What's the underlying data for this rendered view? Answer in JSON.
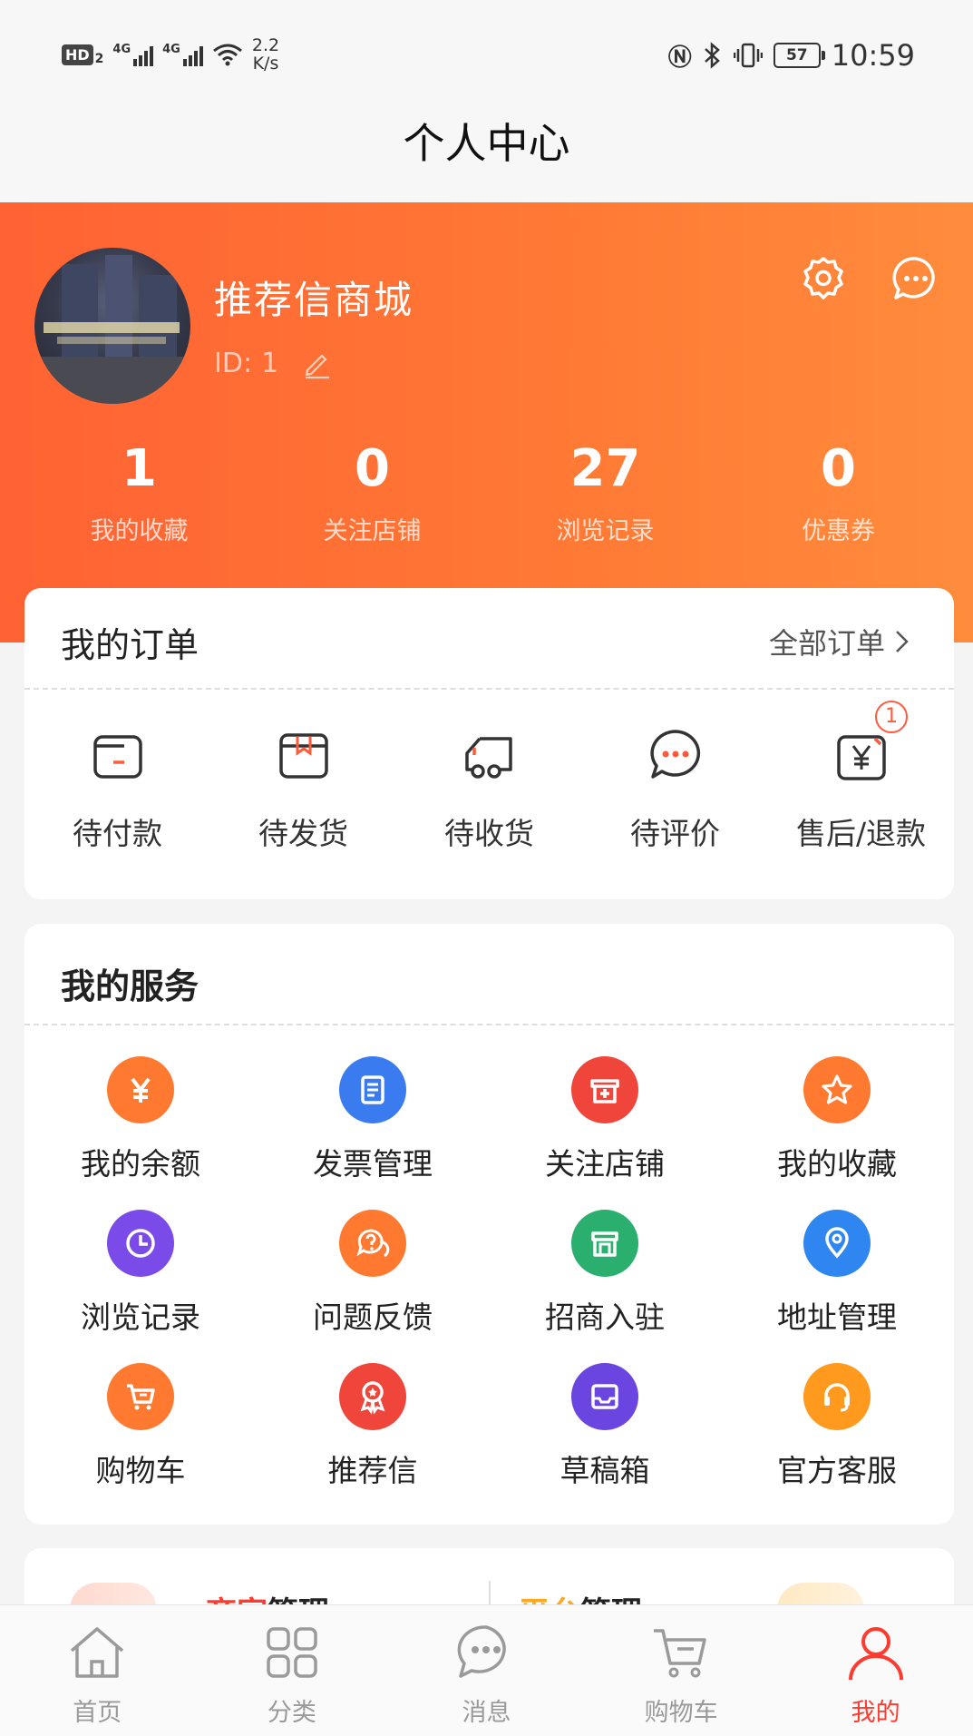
{
  "status_bar": {
    "hd_label": "HD",
    "hd_sub": "2",
    "net1": "4G",
    "net2": "4G",
    "speed_value": "2.2",
    "speed_unit": "K/s",
    "battery": "57",
    "time": "10:59"
  },
  "page": {
    "title": "个人中心"
  },
  "profile": {
    "name": "推荐信商城",
    "id_label": "ID:",
    "id_value": "1"
  },
  "stats": [
    {
      "value": "1",
      "label": "我的收藏"
    },
    {
      "value": "0",
      "label": "关注店铺"
    },
    {
      "value": "27",
      "label": "浏览记录"
    },
    {
      "value": "0",
      "label": "优惠券"
    }
  ],
  "orders": {
    "title": "我的订单",
    "all_label": "全部订单",
    "items": [
      {
        "label": "待付款",
        "icon": "wallet-icon"
      },
      {
        "label": "待发货",
        "icon": "package-icon"
      },
      {
        "label": "待收货",
        "icon": "truck-icon"
      },
      {
        "label": "待评价",
        "icon": "comment-icon"
      },
      {
        "label": "售后/退款",
        "icon": "refund-icon",
        "badge": "1"
      }
    ]
  },
  "services": {
    "title": "我的服务",
    "items": [
      {
        "label": "我的余额",
        "icon": "yen-icon",
        "color": "#ff7a30"
      },
      {
        "label": "发票管理",
        "icon": "invoice-icon",
        "color": "#3a7cf0"
      },
      {
        "label": "关注店铺",
        "icon": "store-plus-icon",
        "color": "#f0453a"
      },
      {
        "label": "我的收藏",
        "icon": "star-icon",
        "color": "#ff7a30"
      },
      {
        "label": "浏览记录",
        "icon": "clock-icon",
        "color": "#7a4be8"
      },
      {
        "label": "问题反馈",
        "icon": "question-icon",
        "color": "#ff7a30"
      },
      {
        "label": "招商入驻",
        "icon": "shop-icon",
        "color": "#2aaf6e"
      },
      {
        "label": "地址管理",
        "icon": "location-icon",
        "color": "#2f86f0"
      },
      {
        "label": "购物车",
        "icon": "cart-icon",
        "color": "#ff7a30"
      },
      {
        "label": "推荐信",
        "icon": "award-icon",
        "color": "#f0453a"
      },
      {
        "label": "草稿箱",
        "icon": "inbox-icon",
        "color": "#6a45e0"
      },
      {
        "label": "官方客服",
        "icon": "headset-icon",
        "color": "#ff9a1f"
      }
    ]
  },
  "management": {
    "left_highlight": "商家",
    "left_rest": "管理",
    "right_highlight": "平台",
    "right_rest": "管理"
  },
  "nav": [
    {
      "label": "首页",
      "icon": "home-icon"
    },
    {
      "label": "分类",
      "icon": "grid-icon"
    },
    {
      "label": "消息",
      "icon": "message-icon"
    },
    {
      "label": "购物车",
      "icon": "cart-icon"
    },
    {
      "label": "我的",
      "icon": "user-icon",
      "active": true
    }
  ],
  "colors": {
    "accent": "#ff6233",
    "active_nav": "#ff3b2f",
    "badge": "#ff5a3a"
  }
}
